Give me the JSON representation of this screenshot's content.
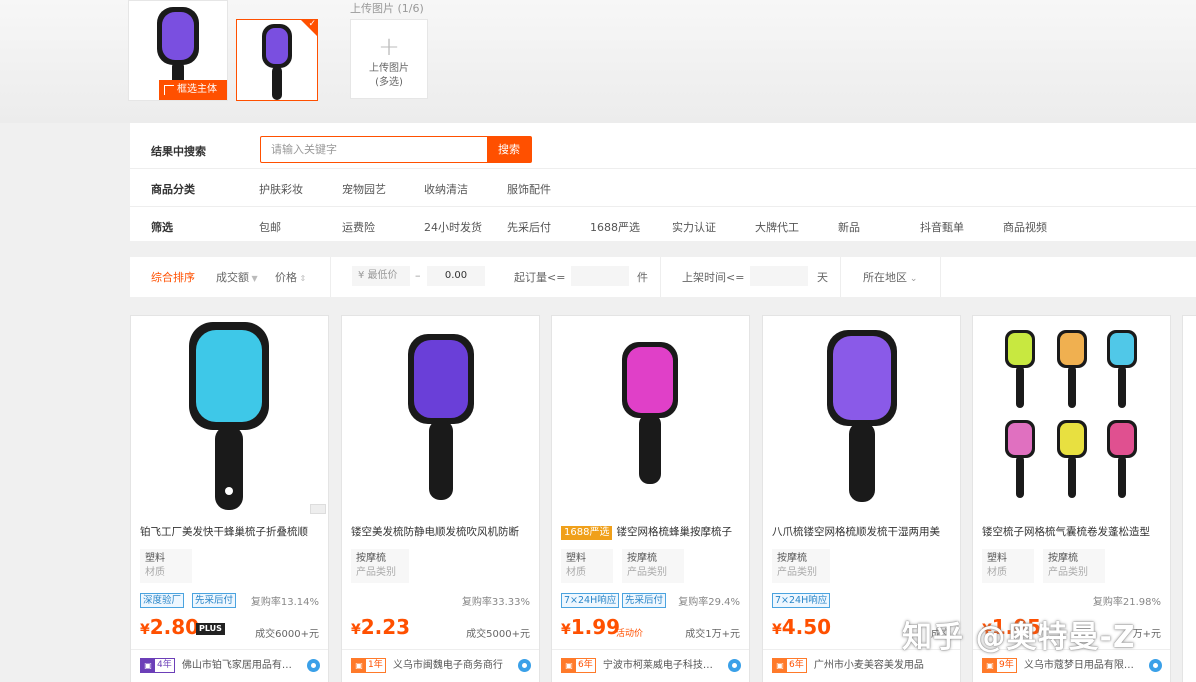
{
  "upload": {
    "crop_label": "框选主体",
    "count": "上传图片 (1/6)",
    "box_line1": "上传图片",
    "box_line2": "(多选)"
  },
  "filters": {
    "search_label": "结果中搜索",
    "search_placeholder": "请输入关键字",
    "search_button": "搜索",
    "category_label": "商品分类",
    "categories": [
      "护肤彩妆",
      "宠物园艺",
      "收纳清洁",
      "服饰配件"
    ],
    "screen_label": "筛选",
    "screens": [
      "包邮",
      "运费险",
      "24小时发货",
      "先采后付",
      "1688严选",
      "实力认证",
      "大牌代工",
      "新品",
      "抖音甄单",
      "商品视频"
    ]
  },
  "sort": {
    "comprehensive": "综合排序",
    "volume": "成交额",
    "price": "价格",
    "min_price_placeholder": "¥ 最低价",
    "dash": "–",
    "max_price": "0.00",
    "moq_label": "起订量<=",
    "moq_unit": "件",
    "listing_label": "上架时间<=",
    "listing_unit": "天",
    "region": "所在地区"
  },
  "products": [
    {
      "title": "铂飞工厂美发快干蜂巢梳子折叠梳顺",
      "badge": "",
      "attrs": [
        {
          "v": "塑料",
          "k": "材质"
        }
      ],
      "tags": [
        "深度验厂",
        "先采后付"
      ],
      "repurchase": "复购率13.14%",
      "price": "2.80",
      "price_suffix": "PLUS",
      "deal": "成交6000+元",
      "years": "4年",
      "shop": "佛山市铂飞家居用品有限公司",
      "color": "#3ec8e8"
    },
    {
      "title": "镂空美发梳防静电顺发梳吹风机防断",
      "badge": "",
      "attrs": [
        {
          "v": "按摩梳",
          "k": "产品类别"
        }
      ],
      "tags": [],
      "repurchase": "复购率33.33%",
      "price": "2.23",
      "price_suffix": "",
      "deal": "成交5000+元",
      "years": "1年",
      "shop": "义乌市闽魏电子商务商行",
      "color": "#6a3fd8"
    },
    {
      "title": "镂空网格梳蜂巢按摩梳子",
      "badge": "1688严选",
      "attrs": [
        {
          "v": "塑料",
          "k": "材质"
        },
        {
          "v": "按摩梳",
          "k": "产品类别"
        }
      ],
      "tags": [
        "7×24H响应",
        "先采后付"
      ],
      "repurchase": "复购率29.4%",
      "price": "1.99",
      "price_suffix": "活动价",
      "deal": "成交1万+元",
      "years": "6年",
      "shop": "宁波市柯莱威电子科技有限公司",
      "color": "#e040c8"
    },
    {
      "title": "八爪梳镂空网格梳顺发梳干湿两用美",
      "badge": "",
      "attrs": [
        {
          "v": "按摩梳",
          "k": "产品类别"
        }
      ],
      "tags": [
        "7×24H响应"
      ],
      "repurchase": "",
      "price": "4.50",
      "price_suffix": "",
      "deal": "成交",
      "years": "6年",
      "shop": "广州市小麦美容美发用品",
      "color": "#8a5ae8"
    },
    {
      "title": "镂空梳子网格梳气囊梳卷发蓬松造型",
      "badge": "",
      "attrs": [
        {
          "v": "塑料",
          "k": "材质"
        },
        {
          "v": "按摩梳",
          "k": "产品类别"
        }
      ],
      "tags": [],
      "repurchase": "复购率21.98%",
      "price": "1.05",
      "price_suffix": "",
      "deal": "万+元",
      "years": "9年",
      "shop": "义乌市蔻梦日用品有限公司",
      "color": "#c8e840"
    }
  ],
  "watermark": "知乎 @奥特曼-Z"
}
